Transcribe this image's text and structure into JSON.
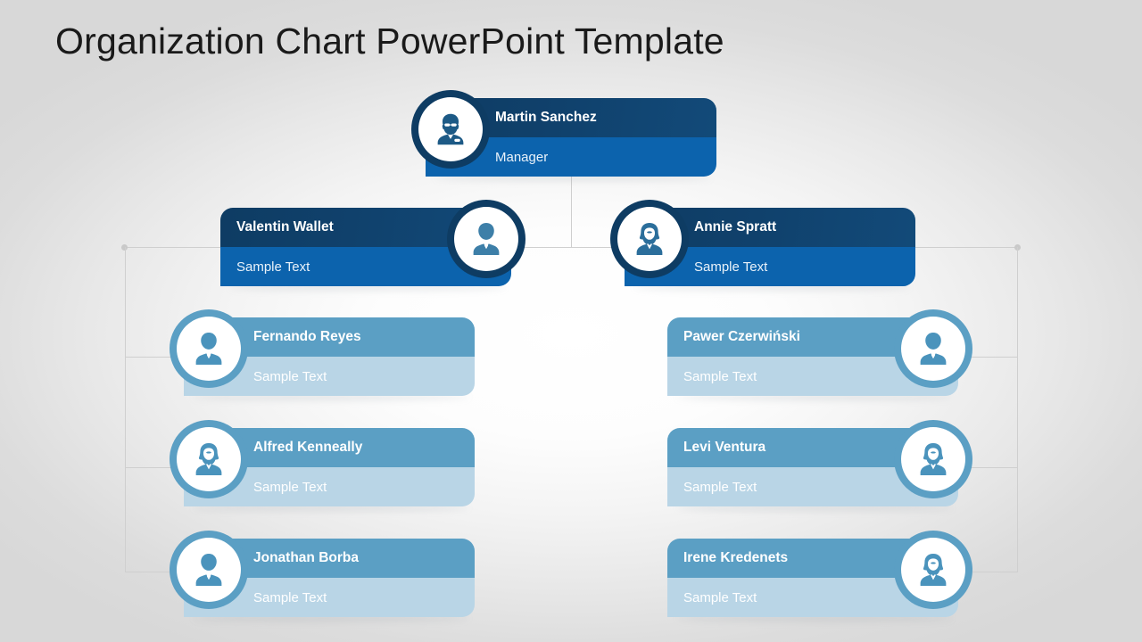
{
  "slide": {
    "title": "Organization Chart PowerPoint Template",
    "background_edge_color": "#dcdcdc",
    "background_center_color": "#ffffff"
  },
  "palette": {
    "level1_top": "#0e3c63",
    "level1_bottom": "#0c63ad",
    "level2_top": "#0e3c63",
    "level2_bottom": "#0c63ad",
    "level3_top": "#5b9fc4",
    "level3_bottom": "#b9d5e6",
    "connector_line": "#cfcfcf",
    "name_text": "#ffffff",
    "role_text": "#f2f7fb",
    "title_text": "#1a1a1a"
  },
  "chart_data": {
    "type": "org-chart",
    "title": "Organization Chart PowerPoint Template",
    "nodes": [
      {
        "id": "n1",
        "name": "Martin Sanchez",
        "role": "Manager",
        "level": 1,
        "style": "dark",
        "avatar": "person-glasses-icon",
        "avatar_side": "left",
        "parent": null
      },
      {
        "id": "n2",
        "name": "Valentin Wallet",
        "role": "Sample Text",
        "level": 2,
        "style": "dark",
        "avatar": "person-male-icon",
        "avatar_side": "right",
        "parent": "n1"
      },
      {
        "id": "n3",
        "name": "Annie Spratt",
        "role": "Sample Text",
        "level": 2,
        "style": "dark",
        "avatar": "person-female-icon",
        "avatar_side": "left",
        "parent": "n1"
      },
      {
        "id": "n4",
        "name": "Fernando Reyes",
        "role": "Sample Text",
        "level": 3,
        "style": "light",
        "avatar": "person-male-icon",
        "avatar_side": "left",
        "parent": "n2"
      },
      {
        "id": "n5",
        "name": "Alfred Kenneally",
        "role": "Sample Text",
        "level": 3,
        "style": "light",
        "avatar": "person-female-icon",
        "avatar_side": "left",
        "parent": "n2"
      },
      {
        "id": "n6",
        "name": "Jonathan Borba",
        "role": "Sample Text",
        "level": 3,
        "style": "light",
        "avatar": "person-male-icon",
        "avatar_side": "left",
        "parent": "n2"
      },
      {
        "id": "n7",
        "name": "Pawer Czerwiński",
        "role": "Sample Text",
        "level": 3,
        "style": "light",
        "avatar": "person-male-icon",
        "avatar_side": "right",
        "parent": "n3"
      },
      {
        "id": "n8",
        "name": "Levi Ventura",
        "role": "Sample Text",
        "level": 3,
        "style": "light",
        "avatar": "person-female-icon",
        "avatar_side": "right",
        "parent": "n3"
      },
      {
        "id": "n9",
        "name": "Irene Kredenets",
        "role": "Sample Text",
        "level": 3,
        "style": "light",
        "avatar": "person-female-icon",
        "avatar_side": "right",
        "parent": "n3"
      }
    ]
  }
}
